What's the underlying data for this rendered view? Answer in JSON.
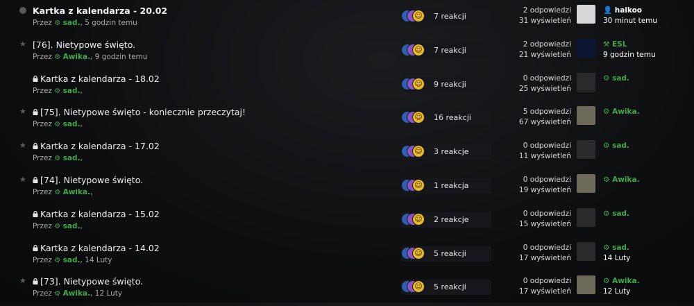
{
  "labels": {
    "by": "Przez"
  },
  "threads": [
    {
      "lead": "dot",
      "locked": false,
      "title": "Kartka z kalendarza - 20.02",
      "author": "sad.",
      "author_time": "5 godzin temu",
      "reactions": "7 reakcji",
      "replies": "2 odpowiedzi",
      "views": "31 wyświetleń",
      "avatar": "white",
      "last_user": "haikoo",
      "last_user_icon": "user-icon",
      "last_user_color": "#ffffff",
      "last_time": "30 minut temu"
    },
    {
      "lead": "star",
      "locked": false,
      "title": "[76]. Nietypowe święto.",
      "author": "Awika.",
      "author_time": "9 godzin temu",
      "reactions": "7 reakcji",
      "replies": "2 odpowiedzi",
      "views": "21 wyświetleń",
      "avatar": "wolf",
      "last_user": "ESL",
      "last_user_icon": "hammer-icon",
      "last_user_color": "#3fa84a",
      "last_time": "9 godzin temu"
    },
    {
      "lead": "none",
      "locked": true,
      "title": "Kartka z kalendarza - 18.02",
      "author": "sad.",
      "author_time": "",
      "reactions": "9 reakcji",
      "replies": "0 odpowiedzi",
      "views": "25 wyświetleń",
      "avatar": "sad",
      "last_user": "sad.",
      "last_user_icon": "gear-icon",
      "last_user_color": "#3fa84a",
      "last_time": ""
    },
    {
      "lead": "star",
      "locked": true,
      "title": "[75]. Nietypowe święto - koniecznie przeczytaj!",
      "author": "sad.",
      "author_time": "",
      "reactions": "16 reakcji",
      "replies": "5 odpowiedzi",
      "views": "67 wyświetleń",
      "avatar": "awika",
      "last_user": "Awika.",
      "last_user_icon": "gear-icon",
      "last_user_color": "#3fa84a",
      "last_time": ""
    },
    {
      "lead": "star",
      "locked": true,
      "title": "Kartka z kalendarza - 17.02",
      "author": "sad.",
      "author_time": "",
      "reactions": "3 reakcje",
      "replies": "0 odpowiedzi",
      "views": "11 wyświetleń",
      "avatar": "sad",
      "last_user": "sad.",
      "last_user_icon": "gear-icon",
      "last_user_color": "#3fa84a",
      "last_time": ""
    },
    {
      "lead": "star",
      "locked": true,
      "title": "[74]. Nietypowe święto.",
      "author": "Awika.",
      "author_time": "",
      "reactions": "1 reakcja",
      "replies": "0 odpowiedzi",
      "views": "19 wyświetleń",
      "avatar": "awika",
      "last_user": "Awika.",
      "last_user_icon": "gear-icon",
      "last_user_color": "#3fa84a",
      "last_time": ""
    },
    {
      "lead": "none",
      "locked": true,
      "title": "Kartka z kalendarza - 15.02",
      "author": "sad.",
      "author_time": "",
      "reactions": "2 reakcje",
      "replies": "0 odpowiedzi",
      "views": "15 wyświetleń",
      "avatar": "sad",
      "last_user": "sad.",
      "last_user_icon": "gear-icon",
      "last_user_color": "#3fa84a",
      "last_time": ""
    },
    {
      "lead": "none",
      "locked": true,
      "title": "Kartka z kalendarza - 14.02",
      "author": "sad.",
      "author_time": "14 Luty",
      "reactions": "5 reakcji",
      "replies": "0 odpowiedzi",
      "views": "17 wyświetleń",
      "avatar": "sad",
      "last_user": "sad.",
      "last_user_icon": "gear-icon",
      "last_user_color": "#3fa84a",
      "last_time": "14 Luty"
    },
    {
      "lead": "star",
      "locked": true,
      "title": "[73]. Nietypowe święto.",
      "author": "Awika.",
      "author_time": "12 Luty",
      "reactions": "5 reakcji",
      "replies": "0 odpowiedzi",
      "views": "17 wyświetleń",
      "avatar": "awika",
      "last_user": "Awika.",
      "last_user_icon": "gear-icon",
      "last_user_color": "#3fa84a",
      "last_time": "12 Luty"
    }
  ]
}
